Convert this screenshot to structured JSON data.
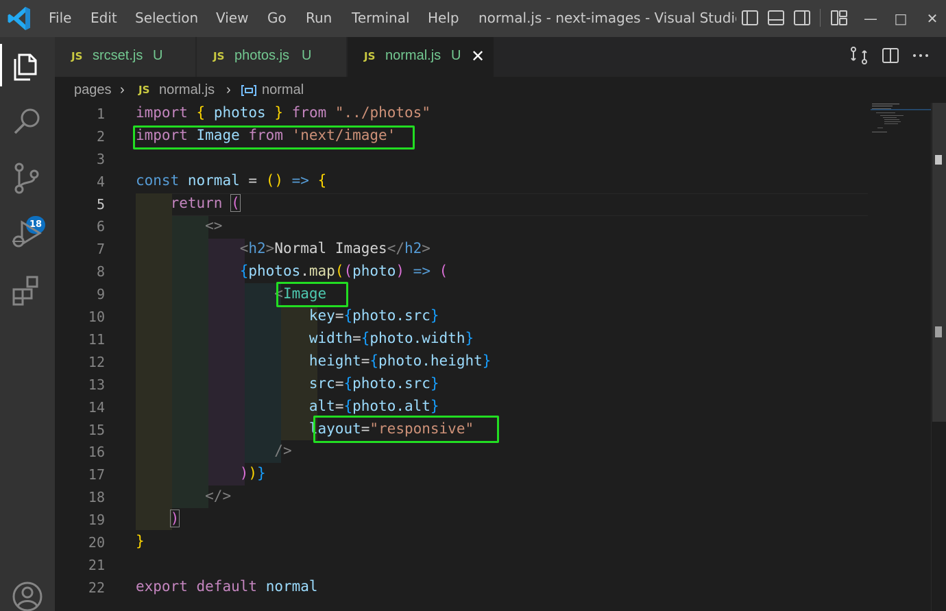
{
  "window": {
    "title": "normal.js - next-images - Visual Studio ...",
    "menu": [
      "File",
      "Edit",
      "Selection",
      "View",
      "Go",
      "Run",
      "Terminal",
      "Help"
    ]
  },
  "activity_bar": {
    "items": [
      "explorer-icon",
      "search-icon",
      "source-control-icon",
      "run-debug-icon",
      "extensions-icon",
      "account-icon"
    ],
    "scm_badge": "18"
  },
  "tabs": [
    {
      "badge": "JS",
      "name": "srcset.js",
      "status": "U"
    },
    {
      "badge": "JS",
      "name": "photos.js",
      "status": "U"
    },
    {
      "badge": "JS",
      "name": "normal.js",
      "status": "U"
    }
  ],
  "active_tab_close": "✕",
  "breadcrumb": {
    "folder": "pages",
    "sep": "›",
    "file_badge": "JS",
    "file": "normal.js",
    "symbol": "normal"
  },
  "line_numbers": [
    "1",
    "2",
    "3",
    "4",
    "5",
    "6",
    "7",
    "8",
    "9",
    "10",
    "11",
    "12",
    "13",
    "14",
    "15",
    "16",
    "17",
    "18",
    "19",
    "20",
    "21",
    "22"
  ],
  "current_line": "5",
  "tokens": {
    "l1": [
      "import",
      "{",
      "photos",
      "}",
      "from",
      "\"../photos\""
    ],
    "l2": [
      "import",
      "Image",
      "from",
      "'next/image'"
    ],
    "l4": [
      "const",
      "normal",
      "=",
      "()",
      "=>",
      "{"
    ],
    "l5": [
      "return",
      "("
    ],
    "l6": [
      "<>"
    ],
    "l7": [
      "<",
      "h2",
      ">",
      "Normal Images",
      "</",
      "h2",
      ">"
    ],
    "l8": [
      "{",
      "photos",
      ".",
      "map",
      "(",
      "(",
      "photo",
      ")",
      "=>",
      "("
    ],
    "l9": [
      "<",
      "Image"
    ],
    "l10": [
      "key",
      "=",
      "{",
      "photo.src",
      "}"
    ],
    "l11": [
      "width",
      "=",
      "{",
      "photo.width",
      "}"
    ],
    "l12": [
      "height",
      "=",
      "{",
      "photo.height",
      "}"
    ],
    "l13": [
      "src",
      "=",
      "{",
      "photo.src",
      "}"
    ],
    "l14": [
      "alt",
      "=",
      "{",
      "photo.alt",
      "}"
    ],
    "l15": [
      "layout",
      "=",
      "\"responsive\""
    ],
    "l16": [
      "/>"
    ],
    "l17": [
      ")",
      ")",
      "}"
    ],
    "l18": [
      "</>"
    ],
    "l19": [
      ")"
    ],
    "l20": [
      "}"
    ],
    "l22": [
      "export",
      "default",
      "normal"
    ]
  },
  "colors": {
    "keyword": "#c586c0",
    "storage": "#569cd6",
    "variable": "#9cdcfe",
    "string": "#ce9178",
    "function": "#dcdcaa",
    "component": "#4ec9b0",
    "highlight_box": "#22dd22",
    "scm_badge": "#0e70c0"
  }
}
